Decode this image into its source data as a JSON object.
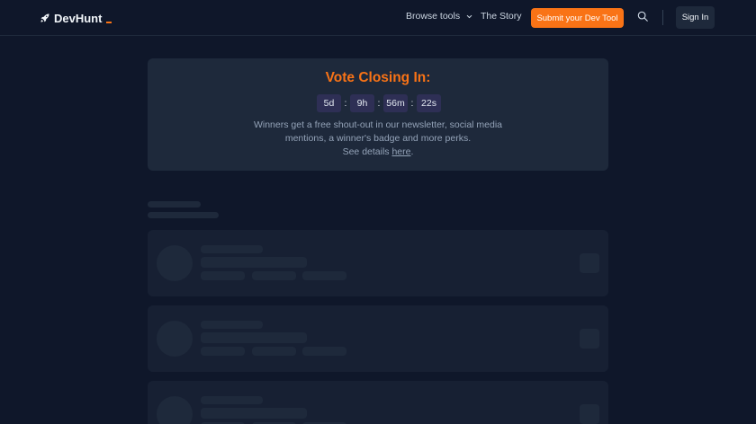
{
  "header": {
    "logo_text": "DevHunt",
    "browse_label": "Browse tools",
    "story_label": "The Story",
    "submit_label": "Submit your Dev Tool",
    "signin_label": "Sign In"
  },
  "vote": {
    "title": "Vote Closing In:",
    "days": "5d",
    "hours": "9h",
    "minutes": "56m",
    "seconds": "22s",
    "separator": ":",
    "desc_line1": "Winners get a free shout-out in our newsletter, social media mentions, a winner's badge and more perks.",
    "details_prefix": "See details ",
    "details_link": "here",
    "details_suffix": "."
  },
  "colors": {
    "background": "#0f172a",
    "accent": "#f97316",
    "panel": "#1e293b",
    "countdown_cell": "#2e2f55"
  },
  "icons": {
    "logo": "rocket-icon",
    "browse": "chevron-down-icon",
    "search": "search-icon"
  }
}
